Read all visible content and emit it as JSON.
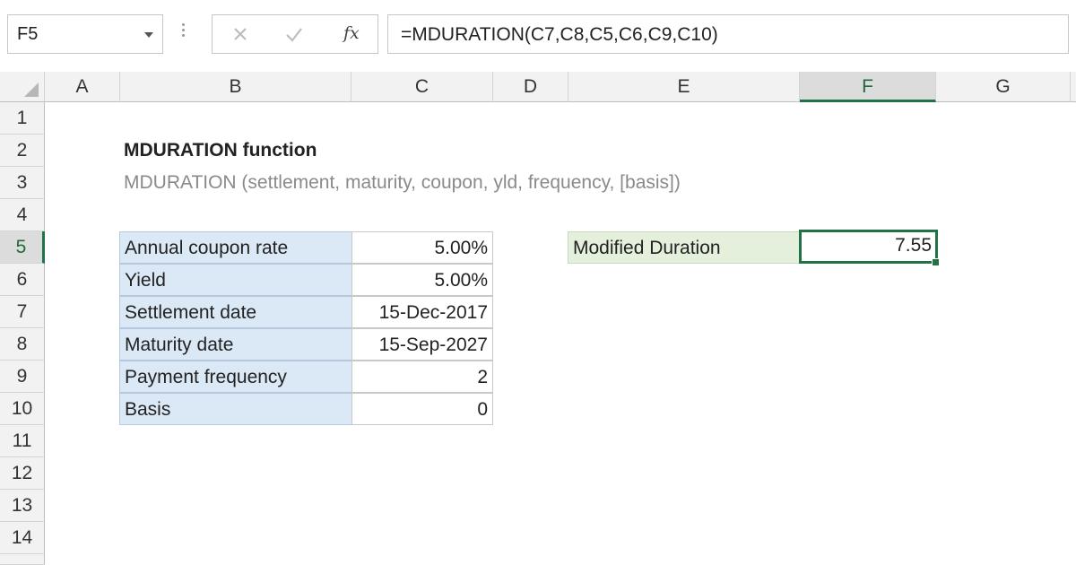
{
  "name_box": "F5",
  "formula_bar": {
    "fx_label": "fx",
    "formula": "=MDURATION(C7,C8,C5,C6,C9,C10)"
  },
  "icons": {
    "cancel": "close-icon",
    "enter": "checkmark-icon",
    "function": "fx-icon",
    "dropdown": "chevron-down-icon"
  },
  "columns": [
    "A",
    "B",
    "C",
    "D",
    "E",
    "F",
    "G"
  ],
  "rows": [
    "1",
    "2",
    "3",
    "4",
    "5",
    "6",
    "7",
    "8",
    "9",
    "10",
    "11",
    "12",
    "13",
    "14"
  ],
  "active_cell": {
    "column": "F",
    "row": "5"
  },
  "sheet": {
    "title": "MDURATION function",
    "syntax": "MDURATION (settlement, maturity, coupon, yld, frequency, [basis])",
    "inputs": [
      {
        "label": "Annual coupon rate",
        "value": "5.00%"
      },
      {
        "label": "Yield",
        "value": "5.00%"
      },
      {
        "label": "Settlement date",
        "value": "15-Dec-2017"
      },
      {
        "label": "Maturity date",
        "value": "15-Sep-2027"
      },
      {
        "label": "Payment frequency",
        "value": "2"
      },
      {
        "label": "Basis",
        "value": "0"
      }
    ],
    "result": {
      "label": "Modified Duration",
      "value": "7.55"
    }
  },
  "colors": {
    "accent_green": "#217346",
    "input_label_fill": "#dbe9f6",
    "result_label_fill": "#e4efdc"
  }
}
